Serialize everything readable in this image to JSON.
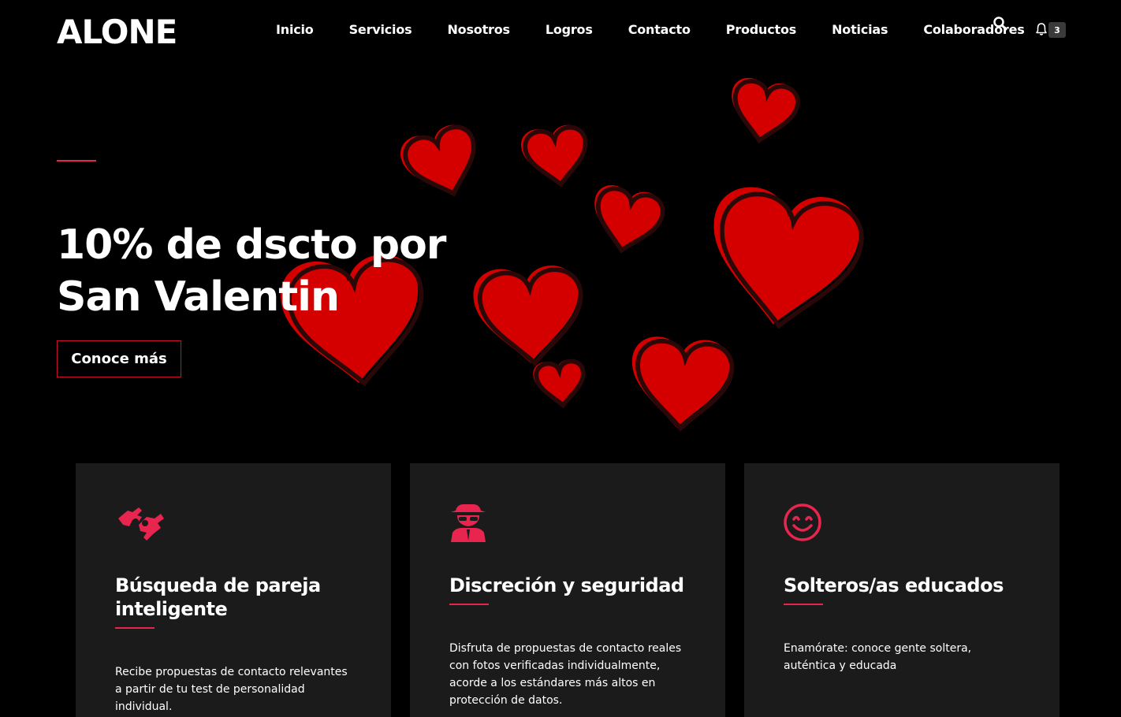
{
  "brand": {
    "logo": "ALONE"
  },
  "nav": {
    "items": [
      {
        "label": "Inicio"
      },
      {
        "label": "Servicios"
      },
      {
        "label": "Nosotros"
      },
      {
        "label": "Logros"
      },
      {
        "label": "Contacto"
      },
      {
        "label": "Productos"
      },
      {
        "label": "Noticias"
      },
      {
        "label": "Colaboradores"
      }
    ],
    "search_icon": "search-icon",
    "bell_icon": "bell-icon",
    "notification_count": "3"
  },
  "hero": {
    "title_line1": "10% de dscto por",
    "title_line2": "San Valentin",
    "cta_label": "Conoce más",
    "image": "red-hearts-illustration"
  },
  "features": [
    {
      "icon": "sign-language-icon",
      "title_line1": "Búsqueda de pareja",
      "title_line2": "inteligente",
      "text": "Recibe propuestas de contacto relevantes a partir de tu test de personalidad individual."
    },
    {
      "icon": "user-secret-icon",
      "title_line1": "Discreción y seguridad",
      "title_line2": "",
      "text": "Disfruta de propuestas de contacto reales con fotos verificadas individualmente, acorde a los estándares más altos en protección de datos."
    },
    {
      "icon": "smile-icon",
      "title_line1": "Solteros/as educados",
      "title_line2": "",
      "text": "Enamórate: conoce gente soltera, auténtica y educada"
    }
  ],
  "colors": {
    "background": "#000000",
    "card_background": "#1b1b1b",
    "accent": "#e8254f",
    "heart_red": "#d40000",
    "button_border": "#c8102e"
  }
}
